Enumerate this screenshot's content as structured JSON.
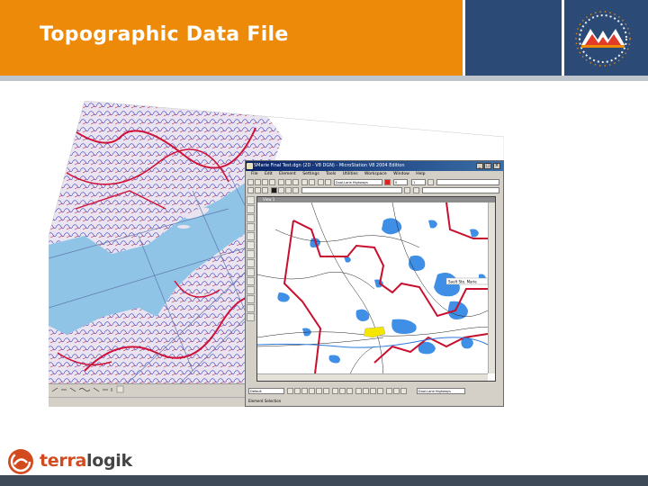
{
  "slide": {
    "title": "Topographic Data File"
  },
  "window": {
    "title": "SMarie Final Test.dgn (2D - V8 DGN) - MicroStation V8 2004 Edition",
    "minimize_label": "_",
    "maximize_label": "□",
    "close_label": "×",
    "menus": [
      "File",
      "Edit",
      "Element",
      "Settings",
      "Tools",
      "Utilities",
      "Workspace",
      "Window",
      "Help"
    ],
    "level_combo": "Dual-Lane Highways",
    "weight_value": "0",
    "style_value": "1",
    "view_title": "View 1",
    "bottom_combo": "Default",
    "bottom_level_combo": "Dual-Lane Highways",
    "status_text": "Element Selection",
    "map_label": "Sault Ste. Marie"
  },
  "brand": {
    "prefix": "terra",
    "suffix": "logik"
  },
  "colors": {
    "header_orange": "#ee8a0a",
    "header_blue": "#2b4a75",
    "footer_bar": "#3e4a58",
    "brand_accent": "#d34a1f"
  }
}
